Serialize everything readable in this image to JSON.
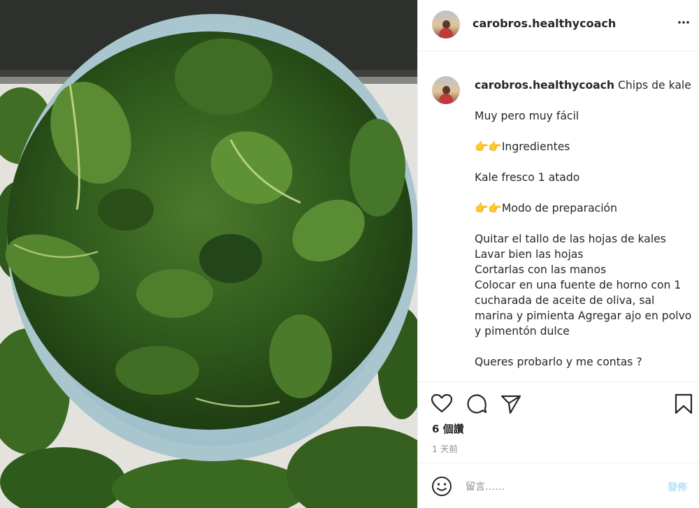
{
  "post": {
    "photo_alt": "kale-chips-in-bowl"
  },
  "header": {
    "username": "carobros.healthycoach",
    "more_icon": "more-horizontal-icon"
  },
  "caption": {
    "username": "carobros.healthycoach",
    "lines": [
      "Chips de kale",
      "",
      "Muy pero muy fácil",
      "",
      "👉👉Ingredientes",
      "",
      "Kale fresco 1 atado",
      "",
      "👉👉Modo de preparación",
      "",
      "Quitar el tallo de las hojas de kales",
      "Lavar bien las hojas",
      "Cortarlas con las manos",
      "Colocar en una fuente de horno con 1",
      "cucharada de aceite de oliva, sal",
      "marina y pimienta Agregar ajo en polvo",
      "y pimentón dulce",
      "",
      "Queres probarlo y me contas ?"
    ]
  },
  "actions": {
    "like_icon": "heart-icon",
    "comment_icon": "comment-icon",
    "share_icon": "paper-plane-icon",
    "save_icon": "bookmark-icon",
    "likes_text": "6 個讚",
    "time_text": "1 天前"
  },
  "comment_box": {
    "emoji_icon": "smiley-icon",
    "placeholder": "留言……",
    "post_label": "發佈",
    "post_label_color": "#b2dffc"
  },
  "colors": {
    "text_primary": "#262626",
    "text_secondary": "#8e8e8e",
    "divider": "#efefef"
  }
}
